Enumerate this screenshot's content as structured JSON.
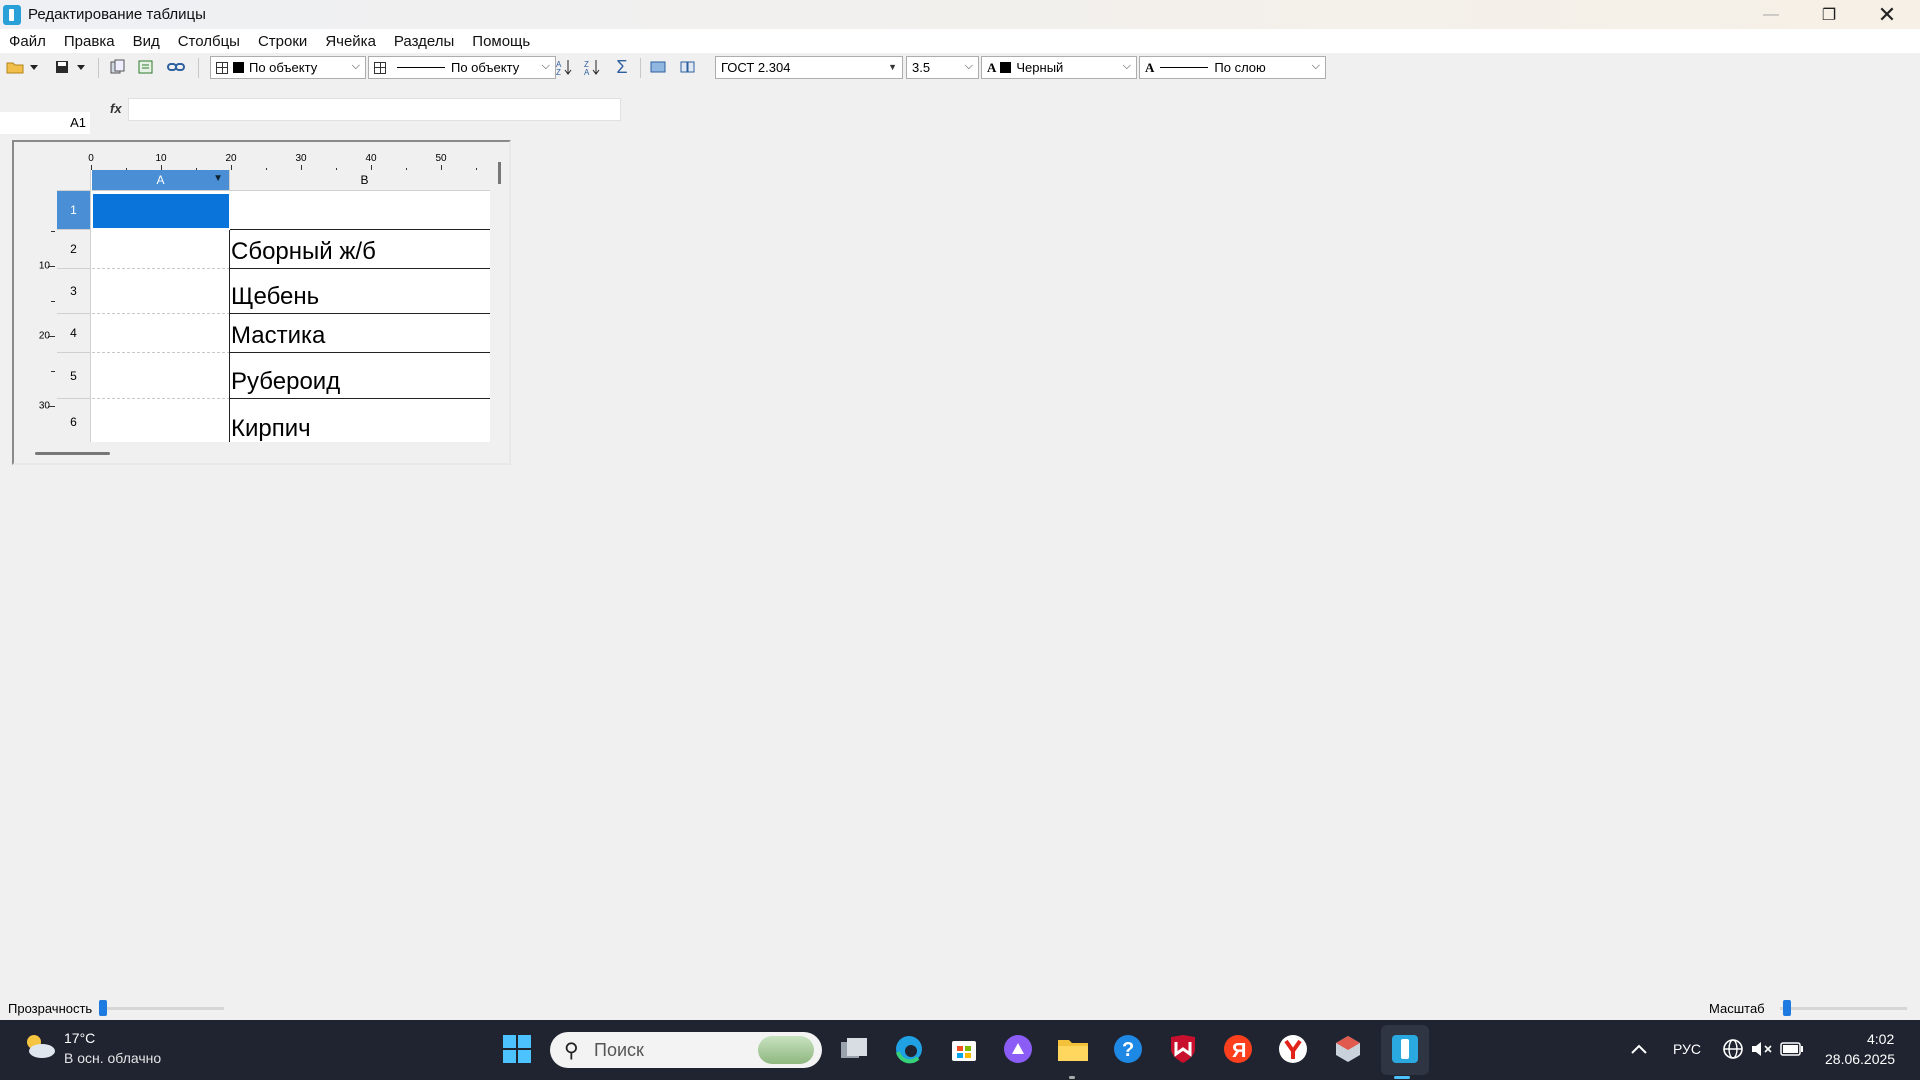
{
  "window": {
    "title": "Редактирование таблицы",
    "minimize": "—",
    "maximize": "❐",
    "close": "✕"
  },
  "menu": [
    "Файл",
    "Правка",
    "Вид",
    "Столбцы",
    "Строки",
    "Ячейка",
    "Разделы",
    "Помощь"
  ],
  "toolbar": {
    "fill_dropdown": "По объекту",
    "line_dropdown": "По объекту",
    "font_dropdown": "ГОСТ 2.304",
    "size_dropdown": "3.5",
    "color_dropdown": "Черный",
    "text_line_dropdown": "По слою",
    "color_swatch": "#000000"
  },
  "formula_bar": {
    "cell_ref": "A1",
    "fx_label": "fx",
    "value": ""
  },
  "sheet": {
    "ruler_top": [
      "0",
      "10",
      "20",
      "30",
      "40",
      "50"
    ],
    "ruler_left": [
      "10",
      "20",
      "30"
    ],
    "columns": [
      "A",
      "B"
    ],
    "rows": [
      {
        "num": "1",
        "a": "",
        "b": ""
      },
      {
        "num": "2",
        "a": "",
        "b": "Сборный ж/б"
      },
      {
        "num": "3",
        "a": "",
        "b": "Щебень"
      },
      {
        "num": "4",
        "a": "",
        "b": "Мастика"
      },
      {
        "num": "5",
        "a": "",
        "b": "Рубероид"
      },
      {
        "num": "6",
        "a": "",
        "b": "Кирпич"
      }
    ],
    "selected_cell": "A1",
    "selection_color": "#0a74da"
  },
  "statusbar": {
    "transparency_label": "Прозрачность",
    "scale_label": "Масштаб"
  },
  "taskbar": {
    "weather_temp": "17°C",
    "weather_desc": "В осн. облачно",
    "search_placeholder": "Поиск",
    "lang": "РУС",
    "time": "4:02",
    "date": "28.06.2025"
  }
}
